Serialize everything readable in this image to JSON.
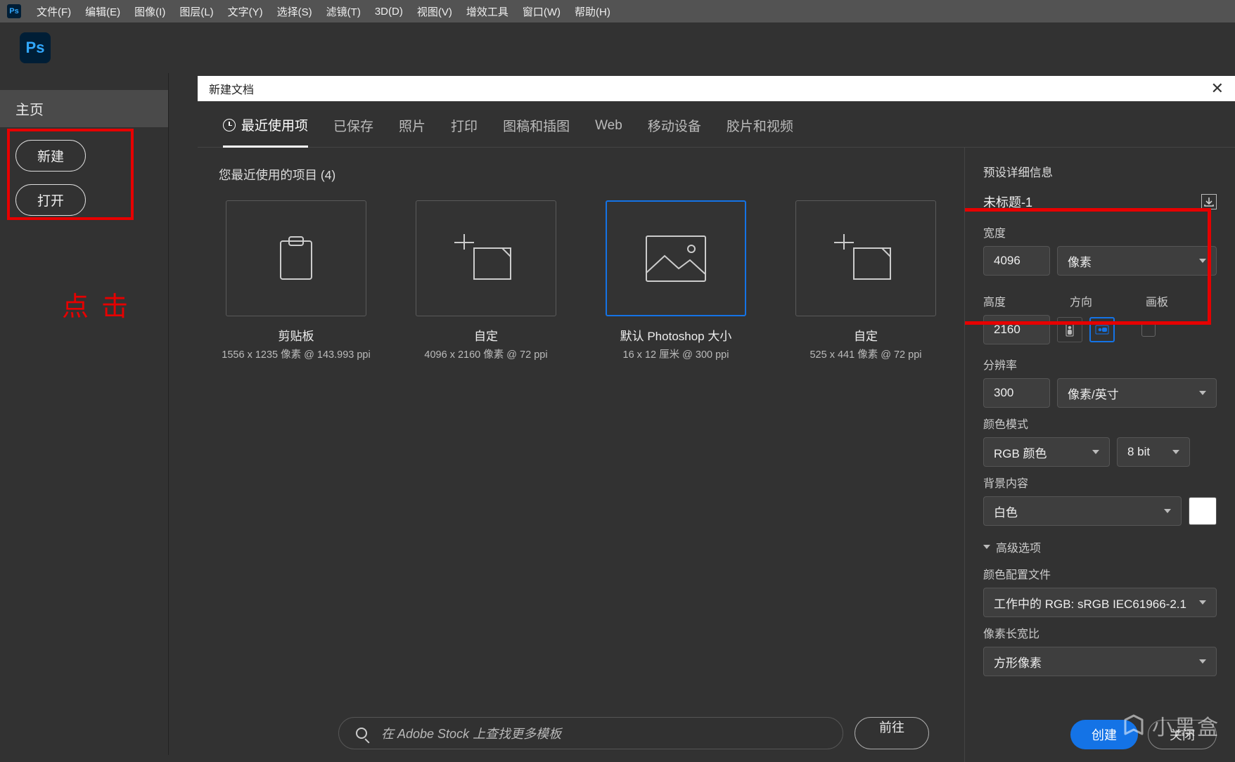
{
  "menubar": {
    "items": [
      "文件(F)",
      "编辑(E)",
      "图像(I)",
      "图层(L)",
      "文字(Y)",
      "选择(S)",
      "滤镜(T)",
      "3D(D)",
      "视图(V)",
      "增效工具",
      "窗口(W)",
      "帮助(H)"
    ]
  },
  "sidebar": {
    "home": "主页",
    "new_btn": "新建",
    "open_btn": "打开",
    "click_annot": "点击"
  },
  "dialog": {
    "title": "新建文档",
    "tabs": [
      "最近使用项",
      "已保存",
      "照片",
      "打印",
      "图稿和插图",
      "Web",
      "移动设备",
      "胶片和视频"
    ],
    "recent_heading": "您最近使用的项目 (4)",
    "cards": [
      {
        "title": "剪贴板",
        "sub": "1556 x 1235 像素 @ 143.993 ppi"
      },
      {
        "title": "自定",
        "sub": "4096 x 2160 像素 @ 72 ppi"
      },
      {
        "title": "默认 Photoshop 大小",
        "sub": "16 x 12 厘米 @ 300 ppi"
      },
      {
        "title": "自定",
        "sub": "525 x 441 像素 @ 72 ppi"
      }
    ],
    "stock_placeholder": "在 Adobe Stock 上查找更多模板",
    "go": "前往"
  },
  "preset": {
    "heading": "预设详细信息",
    "name": "未标题-1",
    "width_label": "宽度",
    "width_value": "4096",
    "unit": "像素",
    "height_label": "高度",
    "height_value": "2160",
    "orient_label": "方向",
    "artboard_label": "画板",
    "res_label": "分辨率",
    "res_value": "300",
    "res_unit": "像素/英寸",
    "mode_label": "颜色模式",
    "mode_value": "RGB 颜色",
    "bits": "8 bit",
    "bg_label": "背景内容",
    "bg_value": "白色",
    "adv": "高级选项",
    "profile_label": "颜色配置文件",
    "profile_value": "工作中的 RGB: sRGB IEC61966-2.1",
    "aspect_label": "像素长宽比",
    "aspect_value": "方形像素",
    "create": "创建",
    "close": "关闭"
  },
  "watermark": "小黑盒"
}
